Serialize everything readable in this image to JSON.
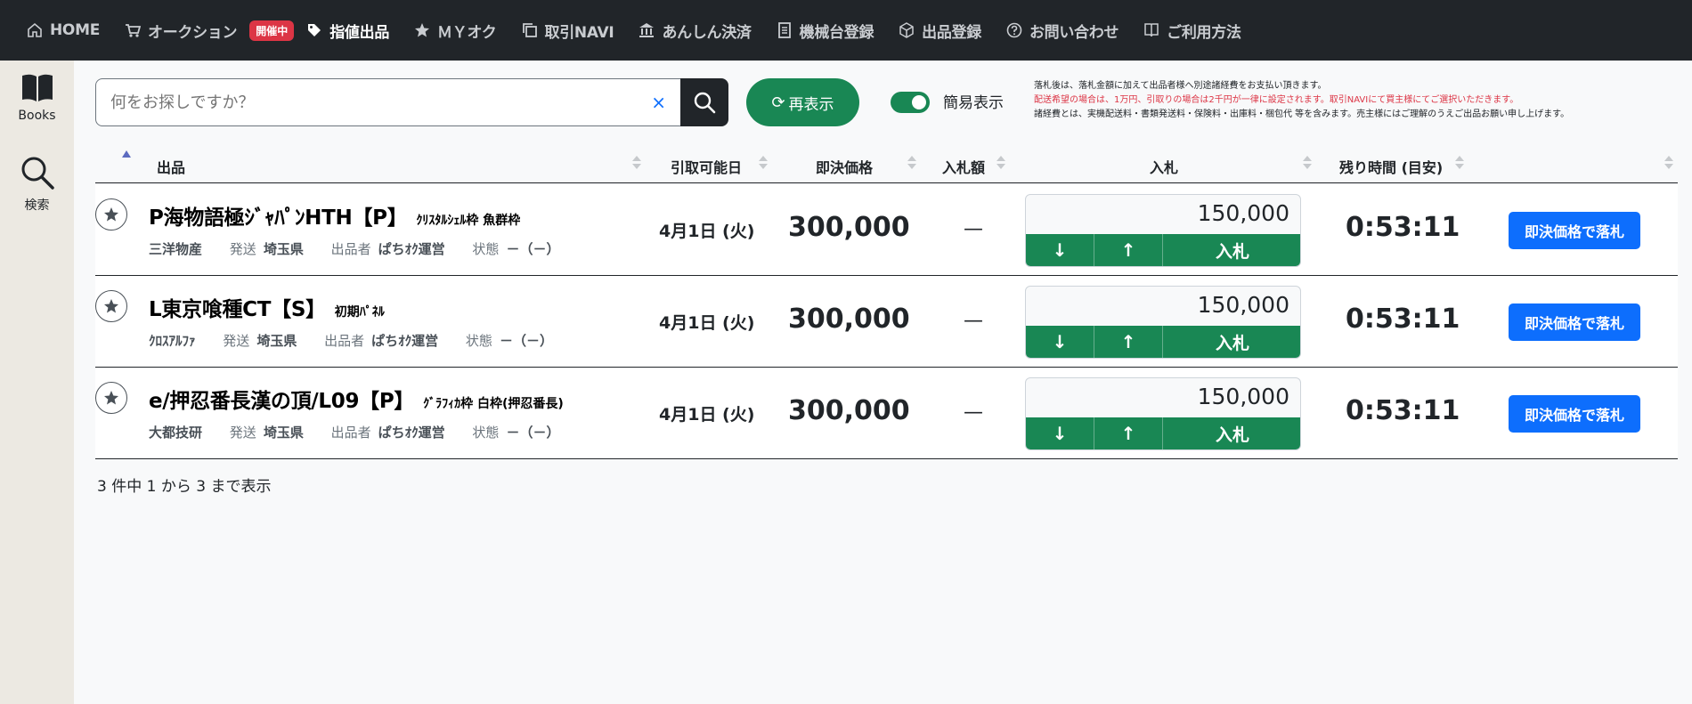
{
  "nav": {
    "items": [
      {
        "label": "HOME",
        "icon": "home-icon"
      },
      {
        "label": "オークション",
        "icon": "cart-icon"
      },
      {
        "label": "指値出品",
        "icon": "tag-icon"
      },
      {
        "label": "ＭＹオク",
        "icon": "star-icon"
      },
      {
        "label": "取引NAVI",
        "icon": "copy-icon"
      },
      {
        "label": "あんしん決済",
        "icon": "bank-icon"
      },
      {
        "label": "機械台登録",
        "icon": "document-icon"
      },
      {
        "label": "出品登録",
        "icon": "box-icon"
      },
      {
        "label": "お問い合わせ",
        "icon": "question-circle-icon"
      },
      {
        "label": "ご利用方法",
        "icon": "book-icon"
      }
    ],
    "badge": "開催中"
  },
  "sidebar": {
    "books": "Books",
    "search": "検索"
  },
  "search": {
    "placeholder": "何をお探しですか？",
    "clear": "×"
  },
  "refresh": {
    "label": "再表示"
  },
  "toggle": {
    "label": "簡易表示",
    "on": true
  },
  "notes": {
    "line1": "落札後は、落札金額に加えて出品者様へ別途諸経費をお支払い頂きます。",
    "line2": "配送希望の場合は、1万円、引取りの場合は2千円が一律に設定されます。取引NAVIにて買主様にてご選択いただきます。",
    "line3": "諸経費とは、実機配送料・書類発送料・保険料・出庫料・梱包代 等を含みます。売主様にはご理解のうえご出品お願い申し上げます。"
  },
  "table": {
    "headers": {
      "item": "出品",
      "pickup": "引取可能日",
      "buyout": "即決価格",
      "bid_amount": "入札額",
      "bid": "入札",
      "remaining": "残り時間 (目安)"
    },
    "meta_labels": {
      "ship": "発送",
      "seller": "出品者",
      "condition": "状態"
    },
    "rows": [
      {
        "title": "P海物語極ｼﾞｬﾊﾟﾝHTH【P】",
        "subtitle": "ｸﾘｽﾀﾙｼｪﾙ枠 魚群枠",
        "maker": "三洋物産",
        "ship": "埼玉県",
        "seller": "ぱちｵｸ運営",
        "condition": "－（－）",
        "date": "4月1日 (火)",
        "price": "300,000",
        "bid_amount": "—",
        "bid_value": "150,000",
        "down": "↓",
        "up": "↑",
        "bid_label": "入札",
        "remaining": "0:53:11",
        "buy_label": "即決価格で落札"
      },
      {
        "title": "L東京喰種CT【S】",
        "subtitle": "初期ﾊﾟﾈﾙ",
        "maker": "ｸﾛｽｱﾙﾌｧ",
        "ship": "埼玉県",
        "seller": "ぱちｵｸ運営",
        "condition": "－（－）",
        "date": "4月1日 (火)",
        "price": "300,000",
        "bid_amount": "—",
        "bid_value": "150,000",
        "down": "↓",
        "up": "↑",
        "bid_label": "入札",
        "remaining": "0:53:11",
        "buy_label": "即決価格で落札"
      },
      {
        "title": "e/押忍番長漢の頂/L09【P】",
        "subtitle": "ｸﾞﾗﾌｨｶ枠 白枠(押忍番長)",
        "maker": "大都技研",
        "ship": "埼玉県",
        "seller": "ぱちｵｸ運営",
        "condition": "－（－）",
        "date": "4月1日 (火)",
        "price": "300,000",
        "bid_amount": "—",
        "bid_value": "150,000",
        "down": "↓",
        "up": "↑",
        "bid_label": "入札",
        "remaining": "0:53:11",
        "buy_label": "即決価格で落札"
      }
    ]
  },
  "footer": {
    "info": "3 件中 1 から 3 まで表示"
  },
  "colors": {
    "nav_bg": "#212529",
    "green": "#198754",
    "blue": "#0d6efd",
    "badge_red": "#dc3545",
    "sidebar_bg": "#ece9e2"
  }
}
